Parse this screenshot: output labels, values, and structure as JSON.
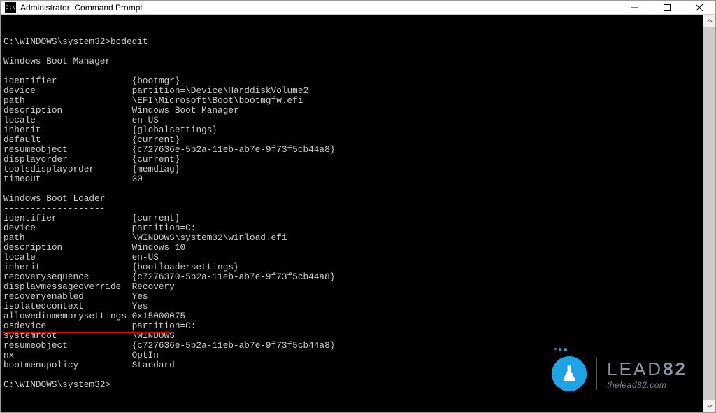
{
  "window": {
    "title": "Administrator: Command Prompt"
  },
  "prompt": {
    "line1_prefix": "C:\\WINDOWS\\system32>",
    "line1_cmd": "bcdedit",
    "end_prefix": "C:\\WINDOWS\\system32>"
  },
  "sections": [
    {
      "header": "Windows Boot Manager",
      "rule": "--------------------",
      "rows": [
        {
          "k": "identifier",
          "v": "{bootmgr}"
        },
        {
          "k": "device",
          "v": "partition=\\Device\\HarddiskVolume2"
        },
        {
          "k": "path",
          "v": "\\EFI\\Microsoft\\Boot\\bootmgfw.efi"
        },
        {
          "k": "description",
          "v": "Windows Boot Manager"
        },
        {
          "k": "locale",
          "v": "en-US"
        },
        {
          "k": "inherit",
          "v": "{globalsettings}"
        },
        {
          "k": "default",
          "v": "{current}"
        },
        {
          "k": "resumeobject",
          "v": "{c727636e-5b2a-11eb-ab7e-9f73f5cb44a8}"
        },
        {
          "k": "displayorder",
          "v": "{current}"
        },
        {
          "k": "toolsdisplayorder",
          "v": "{memdiag}"
        },
        {
          "k": "timeout",
          "v": "30"
        }
      ]
    },
    {
      "header": "Windows Boot Loader",
      "rule": "-------------------",
      "rows": [
        {
          "k": "identifier",
          "v": "{current}"
        },
        {
          "k": "device",
          "v": "partition=C:"
        },
        {
          "k": "path",
          "v": "\\WINDOWS\\system32\\winload.efi"
        },
        {
          "k": "description",
          "v": "Windows 10"
        },
        {
          "k": "locale",
          "v": "en-US"
        },
        {
          "k": "inherit",
          "v": "{bootloadersettings}"
        },
        {
          "k": "recoverysequence",
          "v": "{c7276370-5b2a-11eb-ab7e-9f73f5cb44a8}"
        },
        {
          "k": "displaymessageoverride",
          "v": "Recovery"
        },
        {
          "k": "recoveryenabled",
          "v": "Yes"
        },
        {
          "k": "isolatedcontext",
          "v": "Yes"
        },
        {
          "k": "allowedinmemorysettings",
          "v": "0x15000075"
        },
        {
          "k": "osdevice",
          "v": "partition=C:"
        },
        {
          "k": "systemroot",
          "v": "\\WINDOWS"
        },
        {
          "k": "resumeobject",
          "v": "{c727636e-5b2a-11eb-ab7e-9f73f5cb44a8}"
        },
        {
          "k": "nx",
          "v": "OptIn"
        },
        {
          "k": "bootmenupolicy",
          "v": "Standard"
        }
      ]
    }
  ],
  "watermark": {
    "brand_light": "LEAD",
    "brand_bold": "82",
    "url": "thelead82.com"
  }
}
